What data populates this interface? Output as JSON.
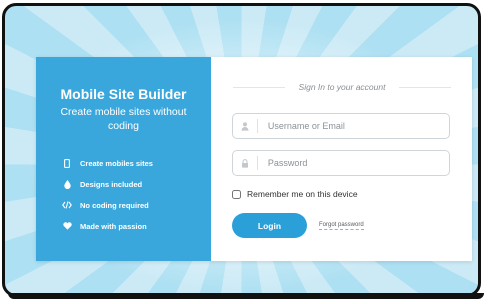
{
  "brand": {
    "title": "Mobile Site Builder",
    "subtitle": "Create mobile sites without coding"
  },
  "features": [
    {
      "icon": "mobile-icon",
      "label": "Create mobiles sites"
    },
    {
      "icon": "droplet-icon",
      "label": "Designs included"
    },
    {
      "icon": "code-icon",
      "label": "No coding required"
    },
    {
      "icon": "heart-icon",
      "label": "Made with passion"
    }
  ],
  "signin": {
    "heading": "Sign In to your account",
    "username_placeholder": "Username or Email",
    "password_placeholder": "Password",
    "remember_label": "Remember me on this device",
    "login_label": "Login",
    "forgot_label": "Forgot password"
  },
  "colors": {
    "panel_blue": "#3aa7dc",
    "button_blue": "#2a9fd8",
    "border": "#111111"
  }
}
